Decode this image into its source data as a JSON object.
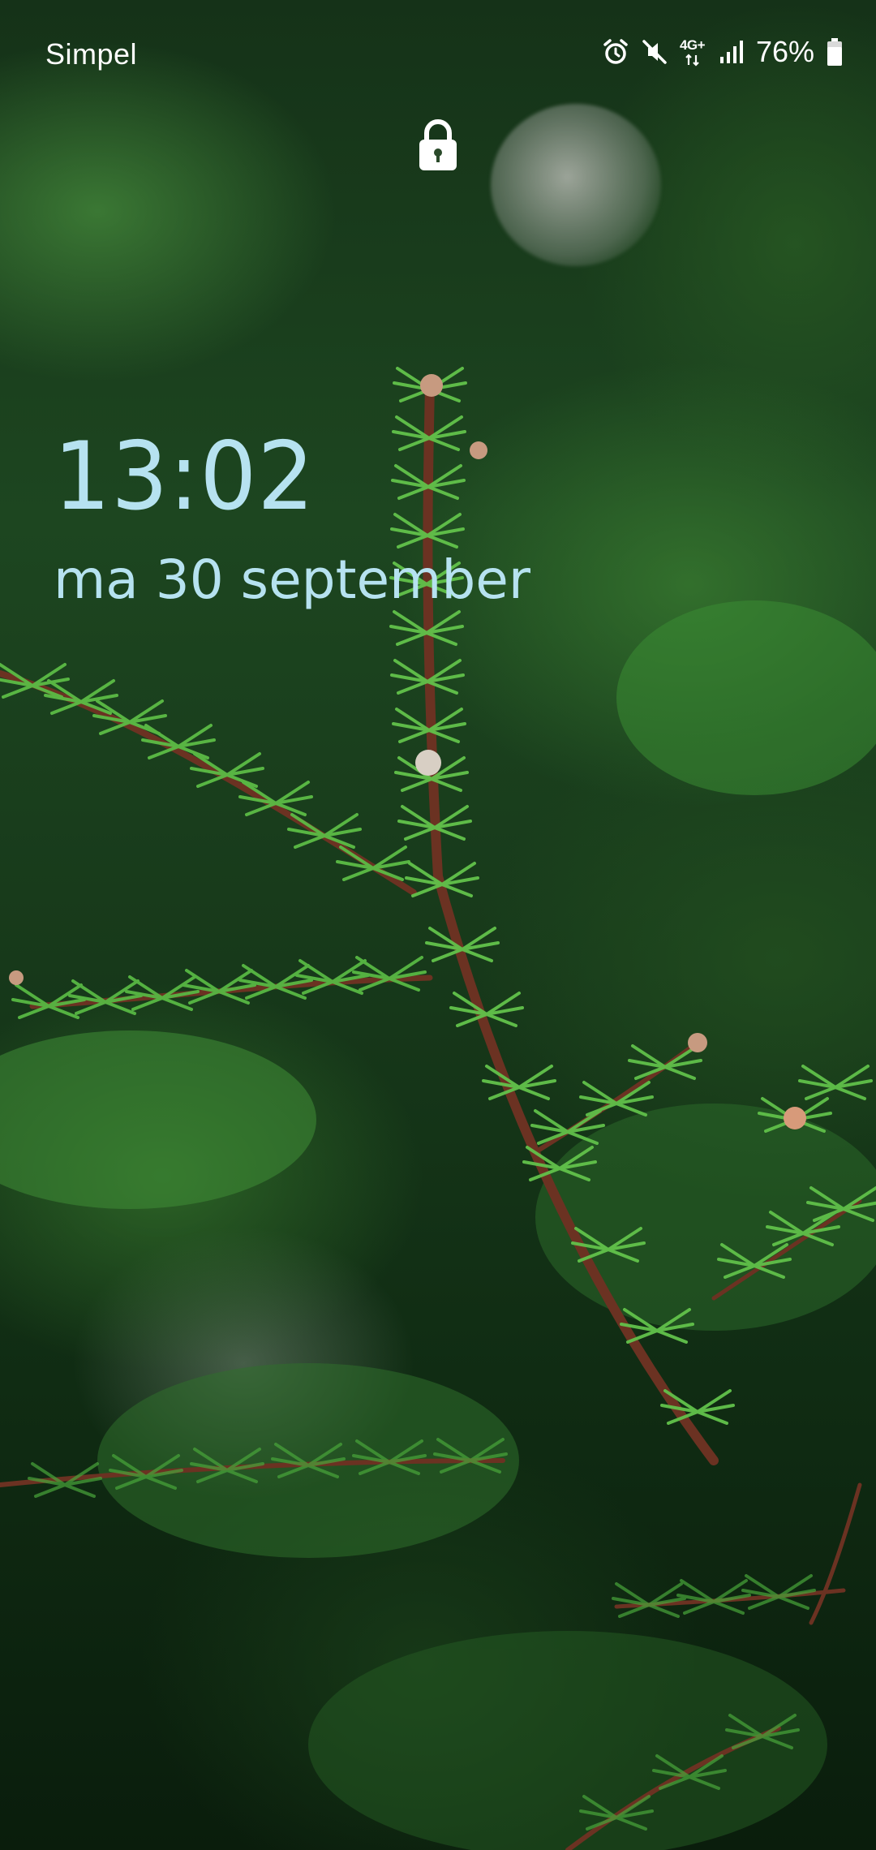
{
  "status_bar": {
    "carrier": "Simpel",
    "network_type": "4G+",
    "battery_percent": "76%",
    "icons": [
      "alarm-icon",
      "mute-icon",
      "network-4g-icon",
      "signal-icon",
      "battery-icon"
    ]
  },
  "lock_screen": {
    "lock_icon": "lock-icon",
    "time": "13:02",
    "date": "ma 30 september"
  },
  "wallpaper": {
    "description_colors": {
      "needle_green": "#5fbf4a",
      "branch_brown": "#6b3222",
      "background_dark": "#0e1f10"
    }
  },
  "colors": {
    "clock_text": "#b6e2f0",
    "status_text": "#ffffff"
  }
}
